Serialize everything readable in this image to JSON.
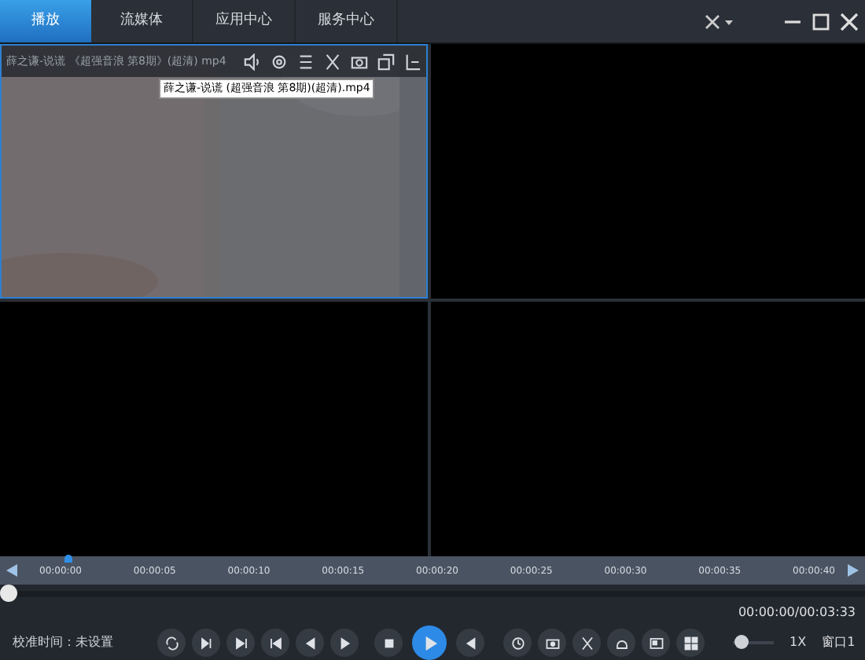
{
  "tabs": [
    {
      "label": "播放",
      "selected": true
    },
    {
      "label": "流媒体",
      "selected": false
    },
    {
      "label": "应用中心",
      "selected": false
    },
    {
      "label": "服务中心",
      "selected": false
    }
  ],
  "panes": [
    {
      "kind": "video",
      "selected": true,
      "title": "薛之谦-说谎 《超强音浪 第8期》(超清) mp4",
      "tooltip": "薛之谦-说谎 (超强音浪 第8期)(超清).mp4"
    },
    {
      "kind": "empty",
      "selected": false
    },
    {
      "kind": "empty",
      "selected": false
    },
    {
      "kind": "empty",
      "selected": false
    }
  ],
  "timeline": {
    "labels": [
      "00:00:00",
      "00:00:05",
      "00:00:10",
      "00:00:15",
      "00:00:20",
      "00:00:25",
      "00:00:30",
      "00:00:35",
      "00:00:40"
    ]
  },
  "progress": {
    "level": 0,
    "time": "00:00:00/00:03:33"
  },
  "calibration": {
    "label": "校准时间：",
    "value": "未设置"
  },
  "volume": {
    "level": 0.05
  },
  "speed": "1X",
  "window_label": "窗口1"
}
